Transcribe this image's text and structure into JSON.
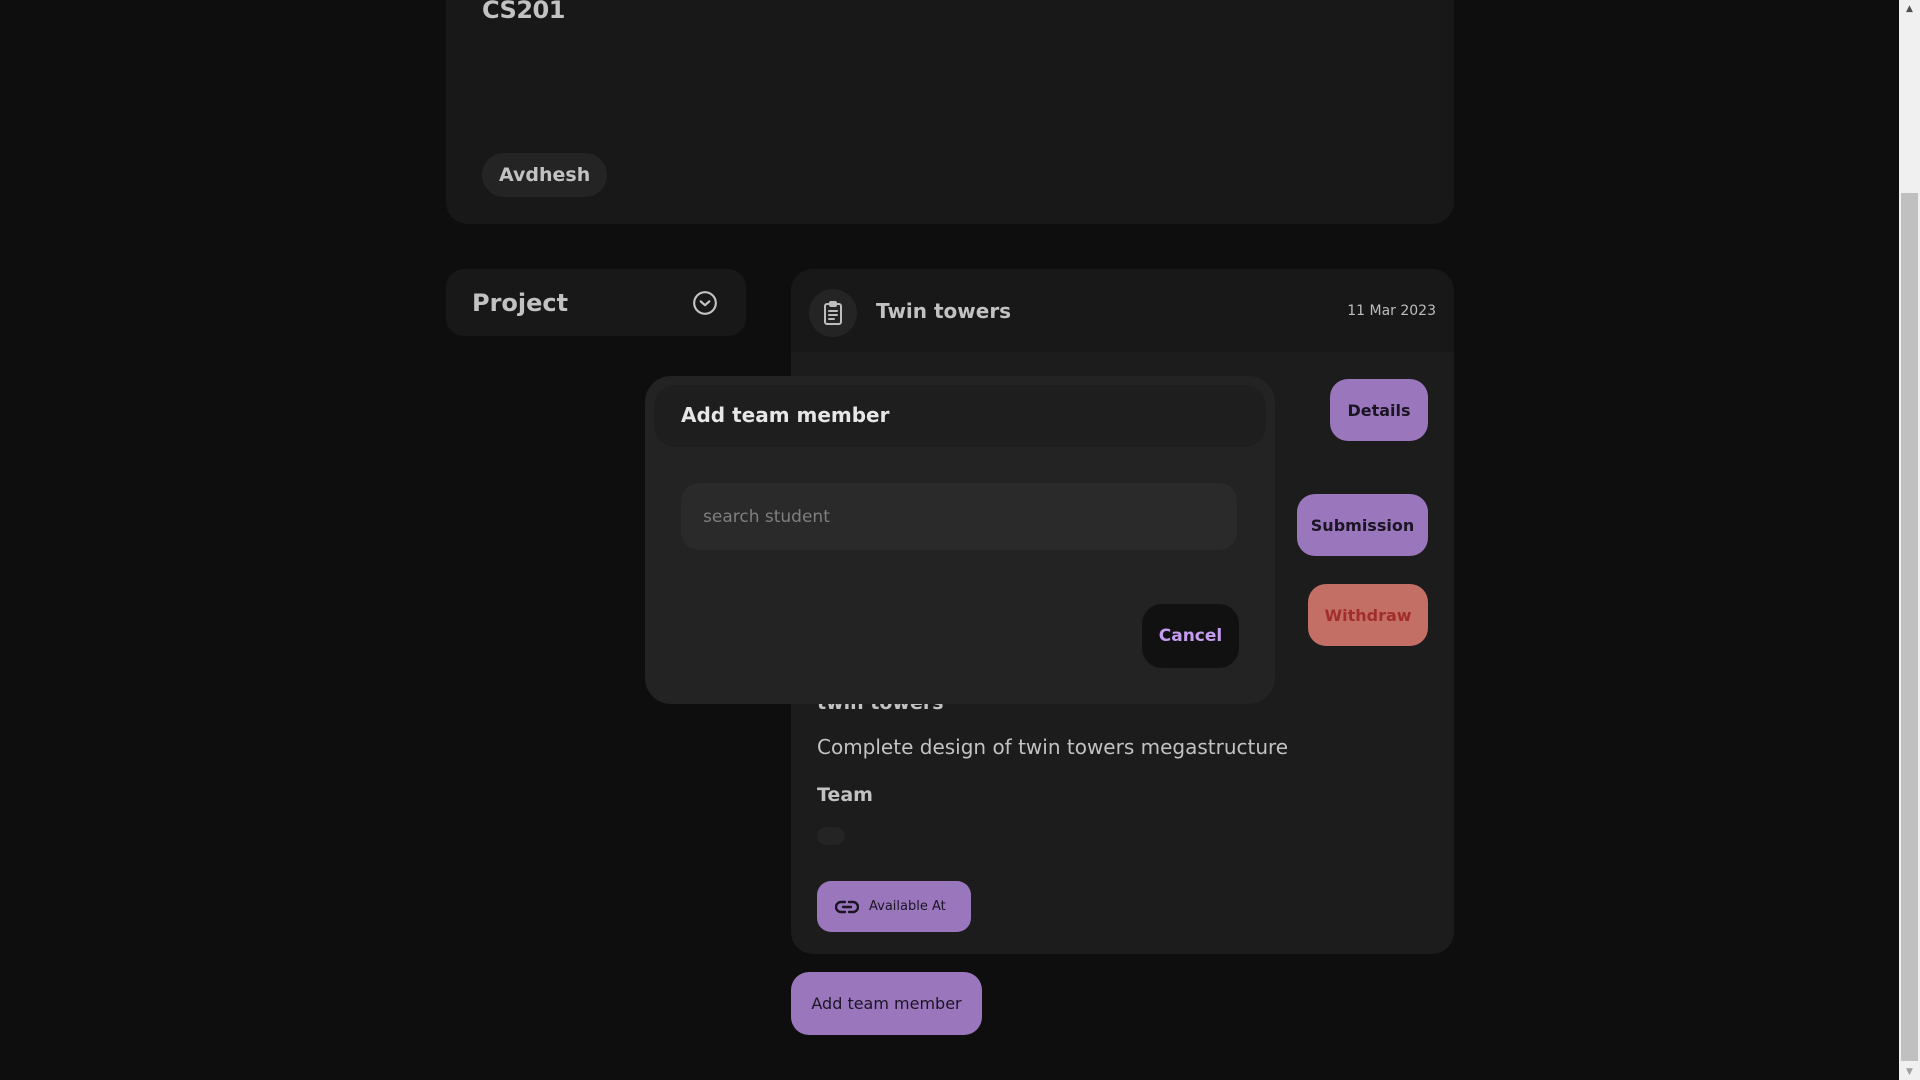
{
  "course": {
    "code": "CS201",
    "teacher": "Avdhesh"
  },
  "sidebar": {
    "dropdown_label": "Project",
    "dropdown_icon": "chevron-down-circle-icon"
  },
  "project": {
    "icon": "clipboard-icon",
    "title": "Twin towers",
    "date": "11 Mar 2023",
    "buttons": {
      "details": "Details",
      "submission": "Submission",
      "withdraw": "Withdraw"
    },
    "subtitle": "twin towers",
    "description": "Complete design of twin towers megastructure",
    "team_heading": "Team",
    "team_members": [],
    "available_at_label": "Available At",
    "available_at_icon": "link-icon"
  },
  "add_member_button": "Add team member",
  "modal": {
    "title": "Add team member",
    "search": {
      "value": "",
      "placeholder": "search student"
    },
    "cancel_label": "Cancel"
  },
  "colors": {
    "accent_purple": "#9a77bd",
    "danger_red": "#c46f66",
    "cancel_text": "#c49cf0",
    "background": "#0e0e0e",
    "card": "#181818"
  },
  "scrollbar": {
    "up_arrow": "▲",
    "down_arrow": "▼"
  }
}
